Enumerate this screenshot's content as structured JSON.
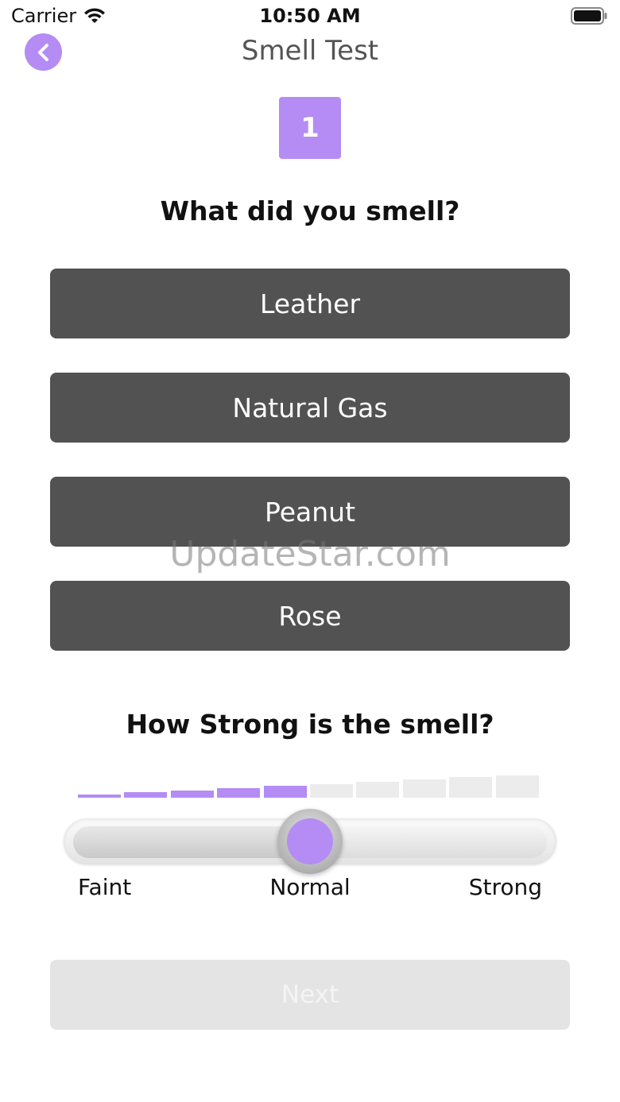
{
  "status_bar": {
    "carrier": "Carrier",
    "time": "10:50 AM"
  },
  "nav": {
    "back_icon": "chevron-left-icon",
    "title": "Smell Test"
  },
  "step": {
    "number": "1"
  },
  "question_smell": "What did you smell?",
  "options": [
    {
      "label": "Leather"
    },
    {
      "label": "Natural Gas"
    },
    {
      "label": "Peanut"
    },
    {
      "label": "Rose"
    }
  ],
  "watermark": "UpdateStar.com",
  "question_strength": "How Strong is the smell?",
  "strength": {
    "level": 5,
    "max_level": 10,
    "slider_fraction": 0.5,
    "labels": {
      "faint": "Faint",
      "normal": "Normal",
      "strong": "Strong"
    }
  },
  "next_label": "Next",
  "colors": {
    "accent": "#b48cf4",
    "option_bg": "#525252",
    "inactive_bar": "#ececec",
    "next_disabled_bg": "#e4e4e4"
  }
}
